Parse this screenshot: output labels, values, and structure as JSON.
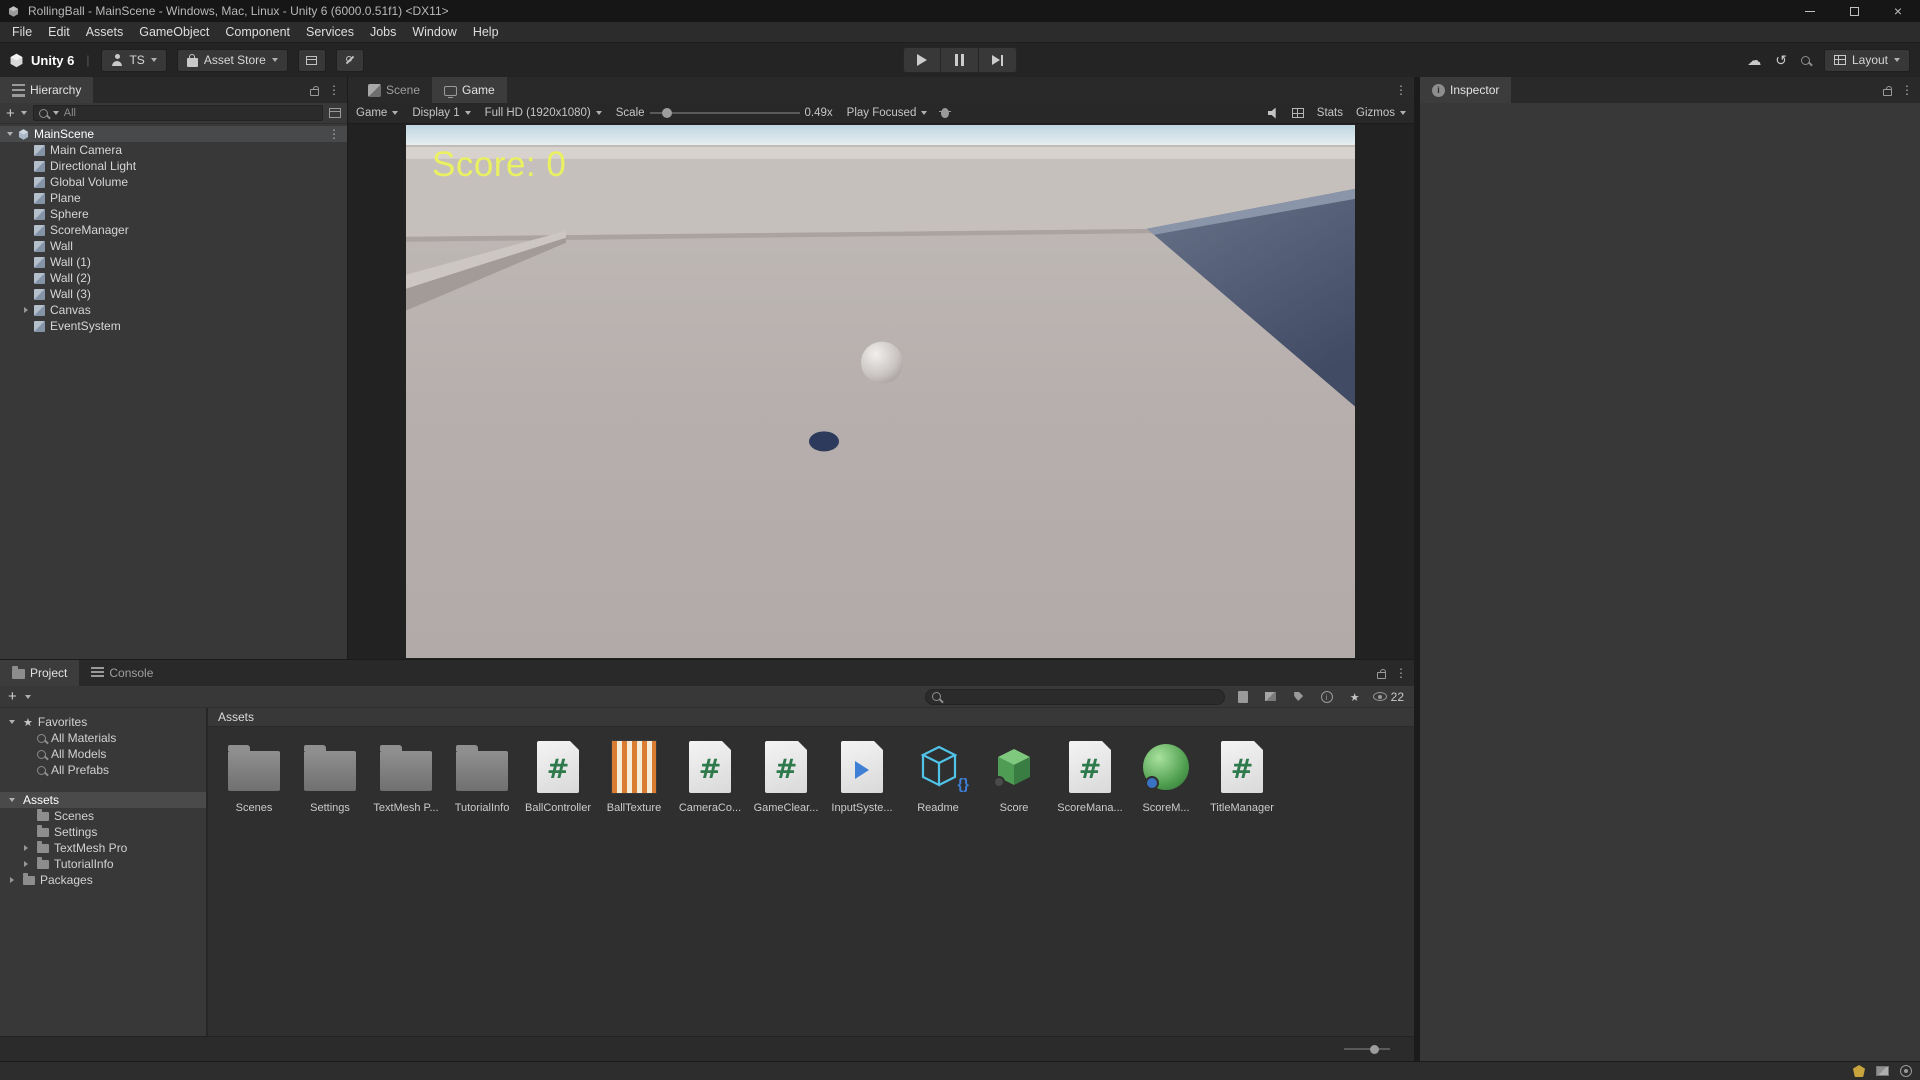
{
  "window": {
    "title": "RollingBall - MainScene - Windows, Mac, Linux - Unity 6 (6000.0.51f1) <DX11>"
  },
  "menu_bar": {
    "items": [
      "File",
      "Edit",
      "Assets",
      "GameObject",
      "Component",
      "Services",
      "Jobs",
      "Window",
      "Help"
    ]
  },
  "toolbar": {
    "product": "Unity 6",
    "account": "TS",
    "asset_store": "Asset Store",
    "layout": "Layout"
  },
  "icons": {
    "search": "magnifier-glyph",
    "lock": "padlock-shape",
    "menu": "kebab ⋮",
    "play": "triangle",
    "pause": "double-bar",
    "step": "triangle-bar",
    "cloud": "☁",
    "history": "↺",
    "favorites": "★"
  },
  "hierarchy_panel": {
    "tab": "Hierarchy",
    "search_placeholder": "All",
    "root": "MainScene",
    "items": [
      {
        "label": "Main Camera"
      },
      {
        "label": "Directional Light"
      },
      {
        "label": "Global Volume"
      },
      {
        "label": "Plane"
      },
      {
        "label": "Sphere"
      },
      {
        "label": "ScoreManager"
      },
      {
        "label": "Wall"
      },
      {
        "label": "Wall (1)"
      },
      {
        "label": "Wall (2)"
      },
      {
        "label": "Wall (3)"
      },
      {
        "label": "Canvas",
        "expandable": true
      },
      {
        "label": "EventSystem"
      }
    ]
  },
  "scene_tabs": {
    "scene": "Scene",
    "game": "Game"
  },
  "game_toolbar": {
    "game_menu": "Game",
    "display": "Display 1",
    "resolution": "Full HD (1920x1080)",
    "scale_label": "Scale",
    "scale_value": "0.49x",
    "play_focused": "Play Focused",
    "stats": "Stats",
    "gizmos": "Gizmos"
  },
  "game_view": {
    "score": "Score: 0",
    "score_color": "#e9f161"
  },
  "inspector_panel": {
    "tab": "Inspector"
  },
  "project_panel": {
    "tab_project": "Project",
    "tab_console": "Console",
    "favorites_label": "Favorites",
    "favorites": [
      "All Materials",
      "All Models",
      "All Prefabs"
    ],
    "assets_label": "Assets",
    "assets_children": [
      {
        "label": "Scenes"
      },
      {
        "label": "Settings"
      },
      {
        "label": "TextMesh Pro",
        "expandable": true
      },
      {
        "label": "TutorialInfo",
        "expandable": true
      }
    ],
    "packages_label": "Packages",
    "breadcrumb": "Assets",
    "hidden_count": "22",
    "assets": [
      {
        "label": "Scenes",
        "type": "folder"
      },
      {
        "label": "Settings",
        "type": "folder"
      },
      {
        "label": "TextMesh P...",
        "type": "folder"
      },
      {
        "label": "TutorialInfo",
        "type": "folder"
      },
      {
        "label": "BallController",
        "type": "script"
      },
      {
        "label": "BallTexture",
        "type": "texture"
      },
      {
        "label": "CameraCo...",
        "type": "script"
      },
      {
        "label": "GameClear...",
        "type": "script"
      },
      {
        "label": "InputSyste...",
        "type": "inputactions"
      },
      {
        "label": "Readme",
        "type": "readme"
      },
      {
        "label": "Score",
        "type": "cube"
      },
      {
        "label": "ScoreMana...",
        "type": "script"
      },
      {
        "label": "ScoreM...",
        "type": "sphere"
      },
      {
        "label": "TitleManager",
        "type": "script"
      }
    ]
  }
}
